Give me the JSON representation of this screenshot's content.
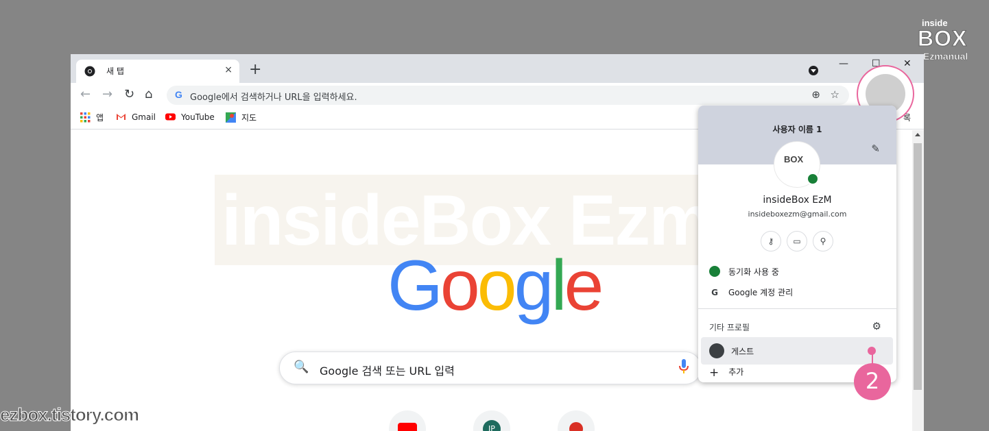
{
  "logo": {
    "line1": "inside",
    "line2": "BOX",
    "line3": "Ezmanual"
  },
  "window": {
    "tab_title": "새 탭",
    "tab_close": "×",
    "new_tab": "+",
    "minimize": "—",
    "maximize": "☐",
    "close": "✕"
  },
  "toolbar": {
    "back": "←",
    "forward": "→",
    "reload": "↻",
    "home": "⌂",
    "omnibox_g": "G",
    "omnibox_placeholder": "Google에서 검색하거나 URL을 입력하세요.",
    "zoom": "⊕",
    "star": "☆"
  },
  "bookmarks": [
    {
      "label": "앱",
      "icon": "apps-grid-icon"
    },
    {
      "label": "Gmail",
      "icon": "gmail-icon"
    },
    {
      "label": "YouTube",
      "icon": "youtube-icon"
    },
    {
      "label": "지도",
      "icon": "maps-icon"
    }
  ],
  "bookmarks_right": "록",
  "page": {
    "watermark": "insideBox Ezmanual",
    "google_letters": [
      {
        "ch": "G",
        "color": "#4285f4"
      },
      {
        "ch": "o",
        "color": "#ea4335"
      },
      {
        "ch": "o",
        "color": "#fbbc05"
      },
      {
        "ch": "g",
        "color": "#4285f4"
      },
      {
        "ch": "l",
        "color": "#34a853"
      },
      {
        "ch": "e",
        "color": "#ea4335"
      }
    ],
    "search_placeholder": "Google 검색 또는 URL 입력",
    "search_icon": "🔍",
    "tile_ip": "IP"
  },
  "profile_menu": {
    "username_header": "사용자 이름 1",
    "edit_icon": "✎",
    "avatar_logo": "BOX",
    "name": "insideBox EzM",
    "email": "insideboxezm@gmail.com",
    "quick_icons": [
      "key-icon",
      "card-icon",
      "location-icon"
    ],
    "quick_glyphs": [
      "⚷",
      "▭",
      "⚲"
    ],
    "sync_label": "동기화 사용 중",
    "account_g": "G",
    "manage_account": "Google 계정 관리",
    "other_profiles": "기타 프로필",
    "gear": "⚙",
    "guest": "게스트",
    "add": "추가",
    "add_plus": "+"
  },
  "step_number": "2",
  "blog_url": "ezbox.tistory.com",
  "colors": {
    "accent": "#e9669d",
    "chrome_frame": "#dee1e6",
    "menu_header": "#cfd3de",
    "sync_green": "#188038"
  }
}
